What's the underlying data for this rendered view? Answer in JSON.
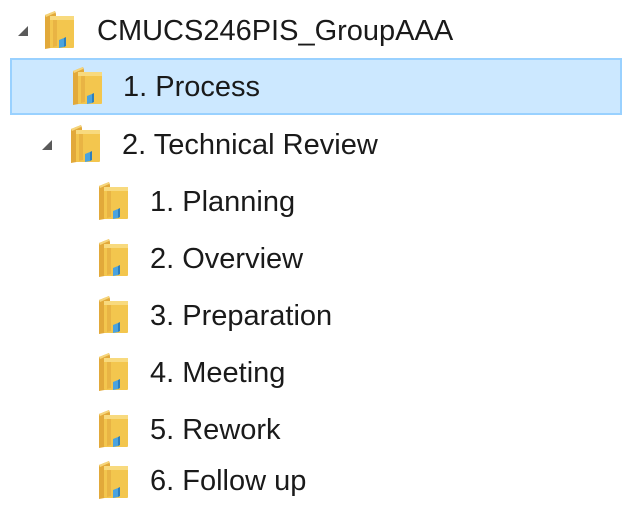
{
  "tree": {
    "root": {
      "label": "CMUCS246PIS_GroupAAA",
      "expanded": true,
      "icon": "folder-icon",
      "children": [
        {
          "label": "1. Process",
          "selected": true,
          "icon": "folder-icon"
        },
        {
          "label": "2. Technical Review",
          "expanded": true,
          "icon": "folder-icon",
          "children": [
            {
              "label": "1. Planning",
              "icon": "folder-icon"
            },
            {
              "label": "2. Overview",
              "icon": "folder-icon"
            },
            {
              "label": "3. Preparation",
              "icon": "folder-icon"
            },
            {
              "label": "4. Meeting",
              "icon": "folder-icon"
            },
            {
              "label": "5. Rework",
              "icon": "folder-icon"
            },
            {
              "label": "6. Follow up",
              "icon": "folder-icon"
            }
          ]
        }
      ]
    }
  },
  "colors": {
    "selection_background": "#cce8ff",
    "selection_border": "#99d1ff",
    "folder_body": "#f3c64e",
    "folder_back": "#e2a93a",
    "folder_accent": "#4aa3df",
    "expander": "#5a5a5a"
  }
}
